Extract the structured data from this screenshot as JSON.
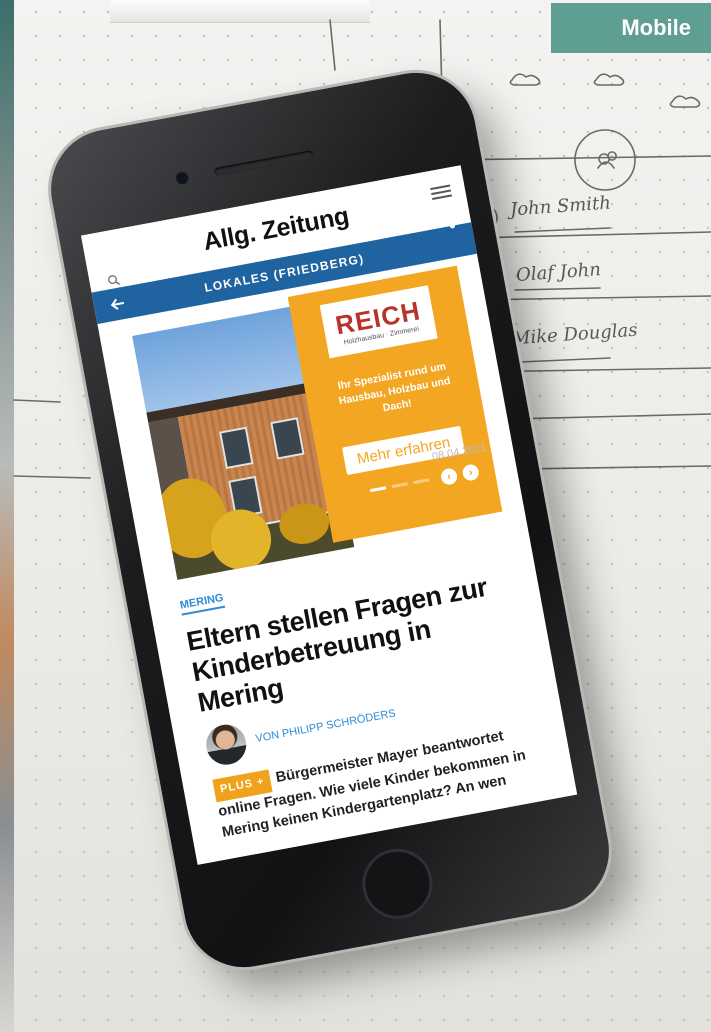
{
  "badge": {
    "label": "Mobile"
  },
  "colors": {
    "badge": "#5f9e92",
    "nav_bar": "#1f64a0",
    "ad_background": "#f3a622",
    "accent_blue": "#2e8bd6",
    "plus_badge": "#f0a21c"
  },
  "sketch": {
    "names": [
      "John Smith",
      "Olaf John",
      "Mike Douglas"
    ]
  },
  "app": {
    "title": "Allg. Zeitung",
    "section": "LOKALES (FRIEDBERG)",
    "icons": [
      "menu-icon",
      "search-icon",
      "back-arrow-icon",
      "share-icon"
    ]
  },
  "ad": {
    "logo": "REICH",
    "logo_sub": "Holzhausbau · Zimmerei",
    "copy": "Ihr Spezialist rund um Hausbau, Holzbau und Dach!",
    "cta": "Mehr erfahren"
  },
  "article": {
    "date": "08.04.2021",
    "kicker": "MERING",
    "headline": "Eltern stellen Fragen zur Kinderbetreuung in Mering",
    "author": "VON PHILIPP SCHRÖDERS",
    "plus_label": "PLUS +",
    "teaser": "Bürgermeister Mayer beantwortet online Fragen. Wie viele Kinder bekommen in Mering keinen Kindergartenplatz? An wen"
  }
}
